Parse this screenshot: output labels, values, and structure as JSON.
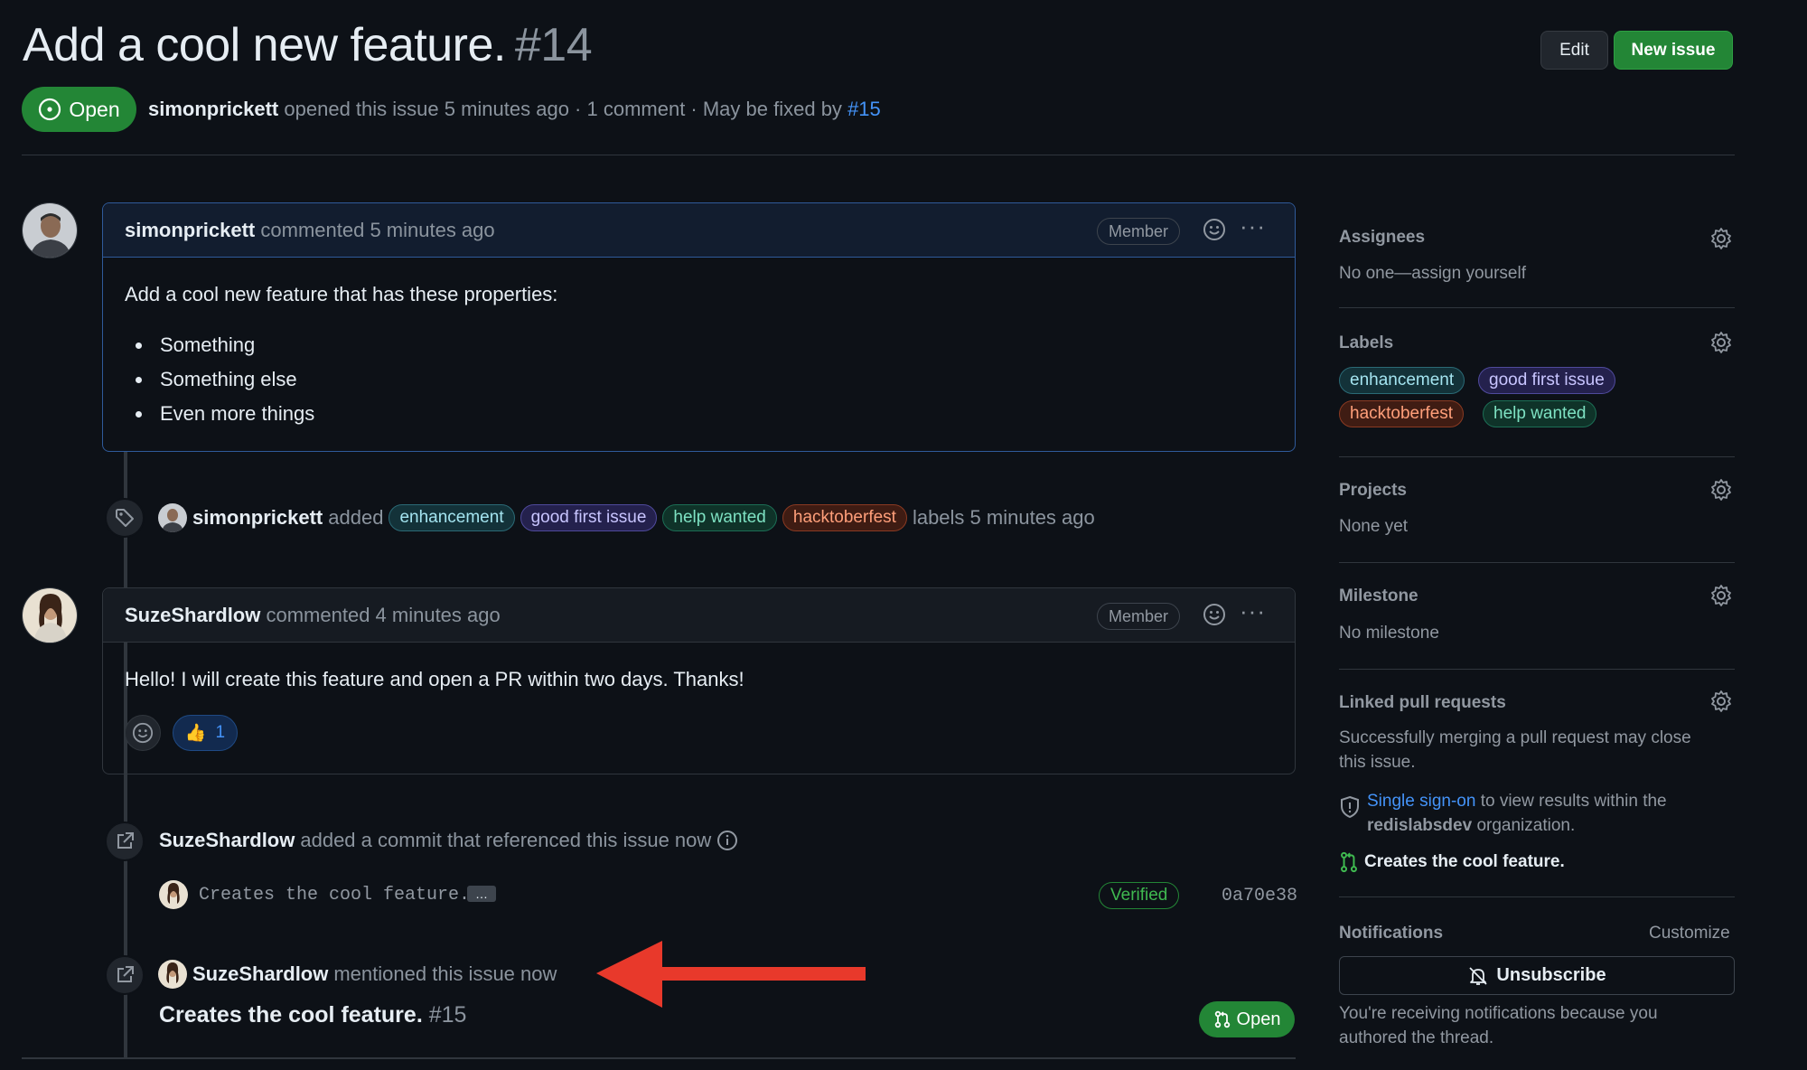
{
  "issue": {
    "title": "Add a cool new feature.",
    "number": "#14",
    "state": "Open",
    "author": "simonprickett",
    "meta_text": "opened this issue 5 minutes ago · 1 comment · May be fixed by",
    "fixed_by": "#15"
  },
  "header_buttons": {
    "edit": "Edit",
    "new_issue": "New issue"
  },
  "comments": [
    {
      "author": "simonprickett",
      "action": "commented 5 minutes ago",
      "role": "Member",
      "body_intro": "Add a cool new feature that has these properties:",
      "bullets": [
        "Something",
        "Something else",
        "Even more things"
      ]
    },
    {
      "author": "SuzeShardlow",
      "action": "commented 4 minutes ago",
      "role": "Member",
      "body": "Hello! I will create this feature and open a PR within two days. Thanks!",
      "reaction": {
        "emoji": "👍",
        "count": "1"
      }
    }
  ],
  "events": {
    "labels": {
      "actor": "simonprickett",
      "verb": "added",
      "labels": [
        "enhancement",
        "good first issue",
        "help wanted",
        "hacktoberfest"
      ],
      "suffix": "labels 5 minutes ago"
    },
    "commit_ref": {
      "actor": "SuzeShardlow",
      "text": "added a commit that referenced this issue now",
      "commit_message": "Creates the cool feature.",
      "ellipsis": "…",
      "verified": "Verified",
      "sha": "0a70e38"
    },
    "mention": {
      "actor": "SuzeShardlow",
      "text": "mentioned this issue now",
      "pr_title": "Creates the cool feature.",
      "pr_number": "#15",
      "pr_state": "Open"
    }
  },
  "sidebar": {
    "assignees": {
      "title": "Assignees",
      "value": "No one—assign yourself"
    },
    "labels": {
      "title": "Labels",
      "items": [
        "enhancement",
        "good first issue",
        "hacktoberfest",
        "help wanted"
      ]
    },
    "projects": {
      "title": "Projects",
      "value": "None yet"
    },
    "milestone": {
      "title": "Milestone",
      "value": "No milestone"
    },
    "linked_prs": {
      "title": "Linked pull requests",
      "desc_line1": "Successfully merging a pull request may close",
      "desc_line2": "this issue.",
      "sso_link": "Single sign-on",
      "sso_text": "to view results within the",
      "org": "redislabsdev",
      "org_suffix": "organization.",
      "pr": "Creates the cool feature."
    },
    "notifications": {
      "title": "Notifications",
      "customize": "Customize",
      "button": "Unsubscribe",
      "note_line1": "You're receiving notifications because you",
      "note_line2": "authored the thread."
    }
  },
  "colors": {
    "background": "#0d1117",
    "open_green": "#238636",
    "link_blue": "#4493f8",
    "annotation_arrow": "#e8392b"
  }
}
